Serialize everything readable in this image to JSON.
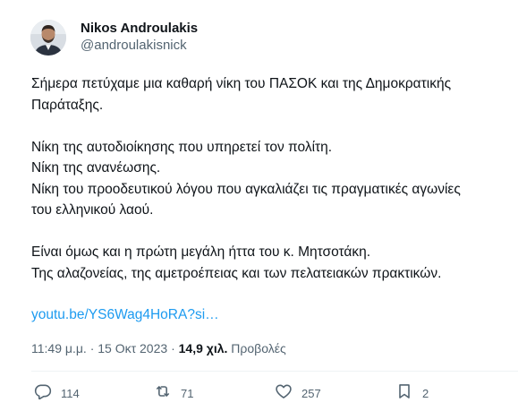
{
  "author": {
    "name": "Nikos Androulakis",
    "handle": "@androulakisnick"
  },
  "tweet": {
    "paragraphs": [
      [
        "Σήμερα πετύχαμε μια καθαρή νίκη του ΠΑΣΟΚ και της Δημοκρατικής",
        "Παράταξης."
      ],
      [
        "Νίκη της αυτοδιοίκησης που υπηρετεί τον πολίτη.",
        "Νίκη της ανανέωσης.",
        "Νίκη του προοδευτικού λόγου που αγκαλιάζει τις πραγματικές αγωνίες",
        "του ελληνικού λαού."
      ],
      [
        "Είναι όμως και η πρώτη μεγάλη ήττα του κ. Μητσοτάκη.",
        "Της αλαζονείας, της αμετροέπειας και των πελατειακών πρακτικών."
      ]
    ],
    "link": "youtu.be/YS6Wag4HoRA?si…"
  },
  "meta": {
    "time": "11:49 μ.μ.",
    "separator": "·",
    "date": "15 Οκτ 2023",
    "views_count": "14,9 χιλ.",
    "views_label": "Προβολές"
  },
  "actions": {
    "replies": "114",
    "retweets": "71",
    "likes": "257",
    "bookmarks": "2"
  },
  "icons": [
    "reply-icon",
    "retweet-icon",
    "like-icon",
    "bookmark-icon"
  ],
  "colors": {
    "link": "#1d9bf0",
    "secondary_text": "#536471",
    "text": "#0f1419"
  }
}
